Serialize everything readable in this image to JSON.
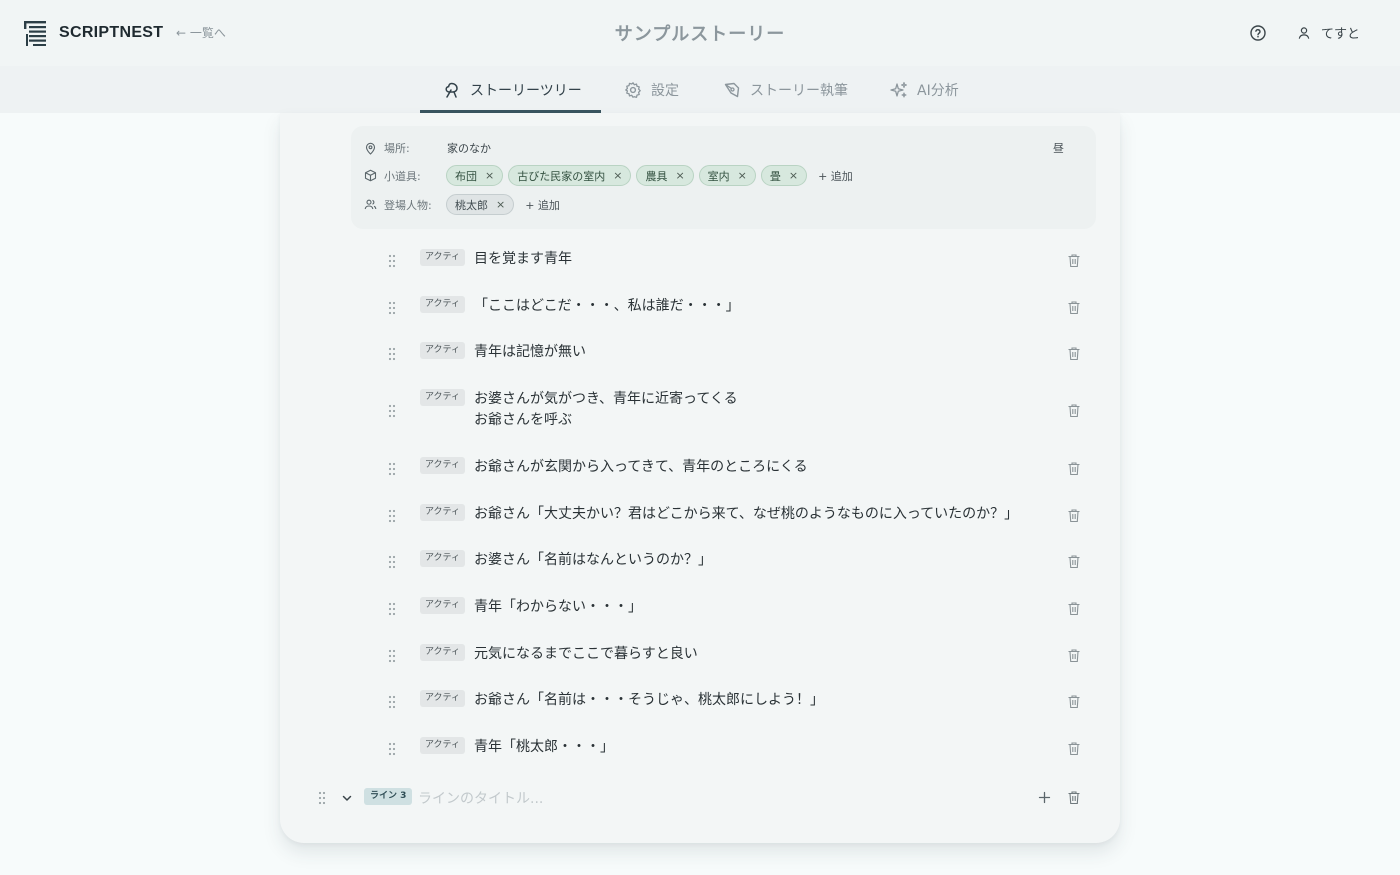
{
  "header": {
    "logo_text": "SCRIPTNEST",
    "back_label": "← 一覧へ",
    "story_title": "サンプルストーリー",
    "user_name": "てすと"
  },
  "tabs": [
    {
      "label": "ストーリーツリー",
      "icon": "tree-icon",
      "active": true
    },
    {
      "label": "設定",
      "icon": "gear-icon",
      "active": false
    },
    {
      "label": "ストーリー執筆",
      "icon": "pen-icon",
      "active": false
    },
    {
      "label": "AI分析",
      "icon": "sparkles-icon",
      "active": false
    }
  ],
  "meta": {
    "place_label": "場所:",
    "place_value": "家のなか",
    "time_value": "昼",
    "props_label": "小道具:",
    "props": [
      "布団",
      "古びた民家の室内",
      "農具",
      "室内",
      "畳"
    ],
    "chars_label": "登場人物:",
    "characters": [
      "桃太郎"
    ],
    "add_label": "+ 追加"
  },
  "actions": {
    "badge": "アクティ",
    "items": [
      {
        "text": "目を覚ます青年"
      },
      {
        "text": "「ここはどこだ・・・、私は誰だ・・・」"
      },
      {
        "text": "青年は記憶が無い"
      },
      {
        "text": "お婆さんが気がつき、青年に近寄ってくる",
        "text2": "お爺さんを呼ぶ"
      },
      {
        "text": "お爺さんが玄関から入ってきて、青年のところにくる"
      },
      {
        "text": "お爺さん「大丈夫かい？君はどこから来て、なぜ桃のようなものに入っていたのか？」"
      },
      {
        "text": "お婆さん「名前はなんというのか？」"
      },
      {
        "text": "青年「わからない・・・」"
      },
      {
        "text": "元気になるまでここで暮らすと良い"
      },
      {
        "text": "お爺さん「名前は・・・そうじゃ、桃太郎にしよう！」"
      },
      {
        "text": "青年「桃太郎・・・」"
      }
    ]
  },
  "line": {
    "badge": "ライン 3",
    "title_placeholder": "ラインのタイトル..."
  },
  "colors": {
    "accent": "#3a5560",
    "chip_green": "#d7e8de",
    "background": "#f7fbfb"
  }
}
